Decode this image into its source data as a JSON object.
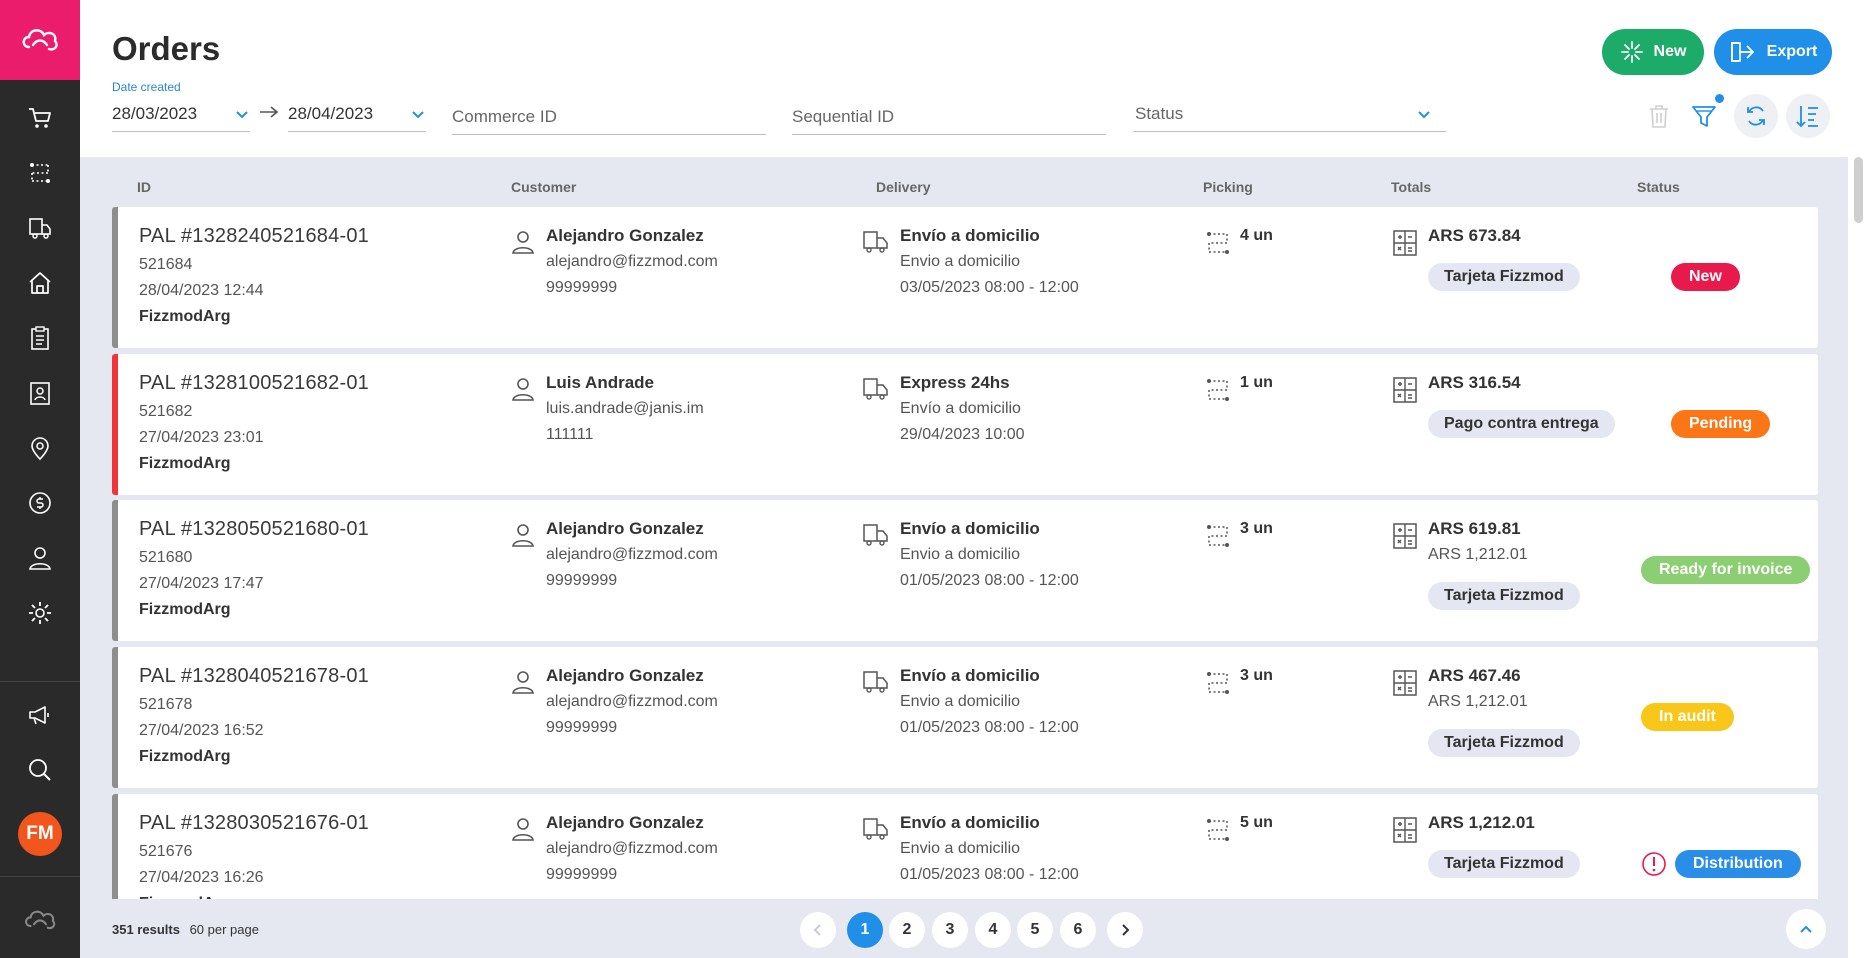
{
  "header": {
    "title": "Orders",
    "new_label": "New",
    "export_label": "Export"
  },
  "filters": {
    "date_label": "Date created",
    "date_from": "28/03/2023",
    "date_to": "28/04/2023",
    "commerce_id_placeholder": "Commerce ID",
    "sequential_id_placeholder": "Sequential ID",
    "status_placeholder": "Status"
  },
  "columns": {
    "id": "ID",
    "customer": "Customer",
    "delivery": "Delivery",
    "picking": "Picking",
    "totals": "Totals",
    "status": "Status"
  },
  "orders": [
    {
      "id": "PAL #1328240521684-01",
      "seq": "521684",
      "date": "28/04/2023 12:44",
      "account": "FizzmodArg",
      "customer_name": "Alejandro Gonzalez",
      "customer_email": "alejandro@fizzmod.com",
      "customer_phone": "99999999",
      "delivery_type": "Envío a domicilio",
      "delivery_method": "Envio a domicilio",
      "delivery_window": "03/05/2023 08:00 - 12:00",
      "picking": "4 un",
      "total": "ARS 673.84",
      "total_secondary": "",
      "payment": "Tarjeta Fizzmod",
      "status": "New",
      "status_color": "#e8194b",
      "bar_color": "#8e8e8e"
    },
    {
      "id": "PAL #1328100521682-01",
      "seq": "521682",
      "date": "27/04/2023 23:01",
      "account": "FizzmodArg",
      "customer_name": "Luis Andrade",
      "customer_email": "luis.andrade@janis.im",
      "customer_phone": "111111",
      "delivery_type": "Express 24hs",
      "delivery_method": "Envío a domicilio",
      "delivery_window": "29/04/2023 10:00",
      "picking": "1 un",
      "total": "ARS 316.54",
      "total_secondary": "",
      "payment": "Pago contra entrega",
      "status": "Pending",
      "status_color": "#fb7616",
      "bar_color": "#f0343a"
    },
    {
      "id": "PAL #1328050521680-01",
      "seq": "521680",
      "date": "27/04/2023 17:47",
      "account": "FizzmodArg",
      "customer_name": "Alejandro Gonzalez",
      "customer_email": "alejandro@fizzmod.com",
      "customer_phone": "99999999",
      "delivery_type": "Envío a domicilio",
      "delivery_method": "Envio a domicilio",
      "delivery_window": "01/05/2023 08:00 - 12:00",
      "picking": "3 un",
      "total": "ARS 619.81",
      "total_secondary": "ARS 1,212.01",
      "payment": "Tarjeta Fizzmod",
      "status": "Ready for invoice",
      "status_color": "#8bcf72",
      "bar_color": "#8e8e8e"
    },
    {
      "id": "PAL #1328040521678-01",
      "seq": "521678",
      "date": "27/04/2023 16:52",
      "account": "FizzmodArg",
      "customer_name": "Alejandro Gonzalez",
      "customer_email": "alejandro@fizzmod.com",
      "customer_phone": "99999999",
      "delivery_type": "Envío a domicilio",
      "delivery_method": "Envio a domicilio",
      "delivery_window": "01/05/2023 08:00 - 12:00",
      "picking": "3 un",
      "total": "ARS 467.46",
      "total_secondary": "ARS 1,212.01",
      "payment": "Tarjeta Fizzmod",
      "status": "In audit",
      "status_color": "#f8c71a",
      "bar_color": "#8e8e8e"
    },
    {
      "id": "PAL #1328030521676-01",
      "seq": "521676",
      "date": "27/04/2023 16:26",
      "account": "FizzmodArg",
      "customer_name": "Alejandro Gonzalez",
      "customer_email": "alejandro@fizzmod.com",
      "customer_phone": "99999999",
      "delivery_type": "Envío a domicilio",
      "delivery_method": "Envio a domicilio",
      "delivery_window": "01/05/2023 08:00 - 12:00",
      "picking": "5 un",
      "total": "ARS 1,212.01",
      "total_secondary": "",
      "payment": "Tarjeta Fizzmod",
      "status": "Distribution",
      "status_color": "#2a8ee8",
      "bar_color": "#8e8e8e"
    }
  ],
  "footer": {
    "results": "351 results",
    "per_page": "60 per page",
    "pages": [
      "1",
      "2",
      "3",
      "4",
      "5",
      "6"
    ],
    "current_page": "1"
  },
  "user": {
    "initials": "FM"
  },
  "colors": {
    "accent": "#1f8fe8",
    "brand": "#ec1c6c",
    "new_button": "#1dab6a"
  },
  "icons": {
    "sidebar": [
      "cart-icon",
      "route-icon",
      "truck-icon",
      "home-icon",
      "clipboard-icon",
      "id-card-icon",
      "location-pin-icon",
      "dollar-icon",
      "user-icon",
      "gear-icon",
      "megaphone-icon",
      "search-icon"
    ],
    "toolbar": [
      "trash-icon",
      "filter-icon",
      "refresh-icon",
      "sort-icon"
    ]
  }
}
